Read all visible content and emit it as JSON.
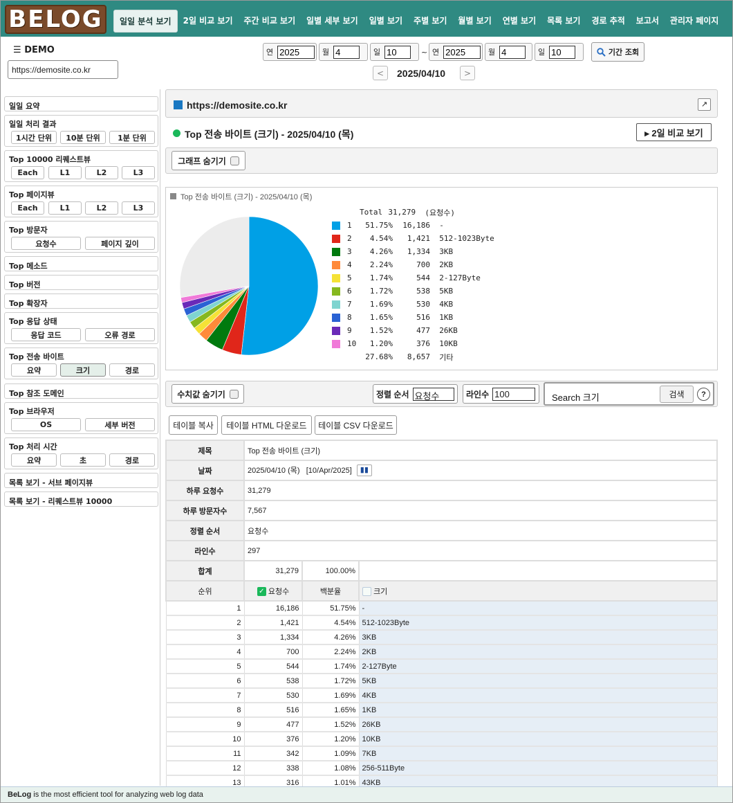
{
  "logo": "BELOG",
  "nav": [
    "일일 분석 보기",
    "2일 비교 보기",
    "주간 비교 보기",
    "일별 세부 보기",
    "일별 보기",
    "주별 보기",
    "월별 보기",
    "연별 보기",
    "목록 보기",
    "경로 추적",
    "보고서",
    "관리자 페이지"
  ],
  "header": {
    "menu_label": "DEMO",
    "site": "https://demosite.co.kr"
  },
  "date_range": {
    "year_label": "연",
    "month_label": "월",
    "day_label": "일",
    "from": {
      "year": "2025",
      "month": "4",
      "day": "10"
    },
    "to": {
      "year": "2025",
      "month": "4",
      "day": "10"
    },
    "tilde": "~",
    "search_label": "기간 조회",
    "current": "2025/04/10",
    "prev": "<",
    "next": ">"
  },
  "sidebar": {
    "daily_summary": "일일 요약",
    "daily_result": {
      "title": "일일 처리 결과",
      "buttons": [
        "1시간 단위",
        "10분 단위",
        "1분 단위"
      ]
    },
    "top_request": {
      "title": "Top 10000 리퀘스트뷰",
      "buttons": [
        "Each",
        "L1",
        "L2",
        "L3"
      ]
    },
    "top_page": {
      "title": "Top 페이지뷰",
      "buttons": [
        "Each",
        "L1",
        "L2",
        "L3"
      ]
    },
    "top_visitor": {
      "title": "Top 방문자",
      "buttons": [
        "요청수",
        "페이지 깊이"
      ]
    },
    "top_method": "Top 메소드",
    "top_version": "Top 버전",
    "top_ext": "Top 확장자",
    "top_status": {
      "title": "Top 응답 상태",
      "buttons": [
        "응답 코드",
        "오류 경로"
      ]
    },
    "top_bytes": {
      "title": "Top 전송 바이트",
      "buttons": [
        "요약",
        "크기",
        "경로"
      ]
    },
    "top_ref": "Top 참조 도메인",
    "top_browser": {
      "title": "Top 브라우저",
      "buttons": [
        "OS",
        "세부 버전"
      ]
    },
    "top_time": {
      "title": "Top 처리 시간",
      "buttons": [
        "요약",
        "초",
        "경로"
      ]
    },
    "list_sub": "목록 보기 - 서브 페이지뷰",
    "list_req": "목록 보기 - 리퀘스트뷰 10000"
  },
  "main": {
    "site": "https://demosite.co.kr",
    "title": "Top 전송 바이트 (크기) - 2025/04/10 (목)",
    "compare_btn": "▸ 2일 비교 보기",
    "hide_graph": "그래프 숨기기",
    "chart_caption": "Top 전송 바이트 (크기) - 2025/04/10 (목)",
    "hide_values": "수치값 숨기기",
    "sort_label": "정렬 순서",
    "sort_value": "요청수",
    "lines_label": "라인수",
    "lines_value": "100",
    "search_placeholder": "Search 크기",
    "search_btn": "검색",
    "help": "?",
    "copy_btn": "테이블 복사",
    "html_btn": "테이블 HTML 다운로드",
    "csv_btn": "테이블 CSV 다운로드"
  },
  "chart_data": {
    "type": "pie",
    "title": "Top 전송 바이트 (크기) - 2025/04/10 (목)",
    "total_label": "Total",
    "total": "31,279",
    "total_unit": "(요청수)",
    "slices": [
      {
        "rank": "1",
        "pct": "51.75%",
        "count": "16,186",
        "label": "-",
        "value": 51.75,
        "color": "#00a0e6"
      },
      {
        "rank": "2",
        "pct": "4.54%",
        "count": "1,421",
        "label": "512-1023Byte",
        "value": 4.54,
        "color": "#e0261a"
      },
      {
        "rank": "3",
        "pct": "4.26%",
        "count": "1,334",
        "label": "3KB",
        "value": 4.26,
        "color": "#007a0e"
      },
      {
        "rank": "4",
        "pct": "2.24%",
        "count": "700",
        "label": "2KB",
        "value": 2.24,
        "color": "#ff8a3a"
      },
      {
        "rank": "5",
        "pct": "1.74%",
        "count": "544",
        "label": "2-127Byte",
        "value": 1.74,
        "color": "#f5e236"
      },
      {
        "rank": "6",
        "pct": "1.72%",
        "count": "538",
        "label": "5KB",
        "value": 1.72,
        "color": "#86b81e"
      },
      {
        "rank": "7",
        "pct": "1.69%",
        "count": "530",
        "label": "4KB",
        "value": 1.69,
        "color": "#7fd4d0"
      },
      {
        "rank": "8",
        "pct": "1.65%",
        "count": "516",
        "label": "1KB",
        "value": 1.65,
        "color": "#2a62d4"
      },
      {
        "rank": "9",
        "pct": "1.52%",
        "count": "477",
        "label": "26KB",
        "value": 1.52,
        "color": "#6a2ab8"
      },
      {
        "rank": "10",
        "pct": "1.20%",
        "count": "376",
        "label": "10KB",
        "value": 1.2,
        "color": "#f07ad8"
      },
      {
        "rank": "",
        "pct": "27.68%",
        "count": "8,657",
        "label": "기타",
        "value": 27.68,
        "color": "#ececec"
      }
    ]
  },
  "info": {
    "title_h": "제목",
    "title_v": "Top 전송 바이트 (크기)",
    "date_h": "날짜",
    "date_v": "2025/04/10 (목)   [10/Apr/2025]",
    "req_h": "하루 요청수",
    "req_v": "31,279",
    "vis_h": "하루 방문자수",
    "vis_v": "7,567",
    "sort_h": "정렬 순서",
    "sort_v": "요청수",
    "lines_h": "라인수",
    "lines_v": "297",
    "sum_h": "합계",
    "sum_count": "31,279",
    "sum_pct": "100.00%",
    "col_rank": "순위",
    "col_req": "요청수",
    "col_pct": "백분율",
    "col_size": "크기"
  },
  "rows": [
    [
      "1",
      "16,186",
      "51.75%",
      "-"
    ],
    [
      "2",
      "1,421",
      "4.54%",
      "512-1023Byte"
    ],
    [
      "3",
      "1,334",
      "4.26%",
      "3KB"
    ],
    [
      "4",
      "700",
      "2.24%",
      "2KB"
    ],
    [
      "5",
      "544",
      "1.74%",
      "2-127Byte"
    ],
    [
      "6",
      "538",
      "1.72%",
      "5KB"
    ],
    [
      "7",
      "530",
      "1.69%",
      "4KB"
    ],
    [
      "8",
      "516",
      "1.65%",
      "1KB"
    ],
    [
      "9",
      "477",
      "1.52%",
      "26KB"
    ],
    [
      "10",
      "376",
      "1.20%",
      "10KB"
    ],
    [
      "11",
      "342",
      "1.09%",
      "7KB"
    ],
    [
      "12",
      "338",
      "1.08%",
      "256-511Byte"
    ],
    [
      "13",
      "316",
      "1.01%",
      "43KB"
    ]
  ],
  "footer": {
    "brand": "BeLog",
    "text": " is the most efficient tool for analyzing web log data"
  }
}
